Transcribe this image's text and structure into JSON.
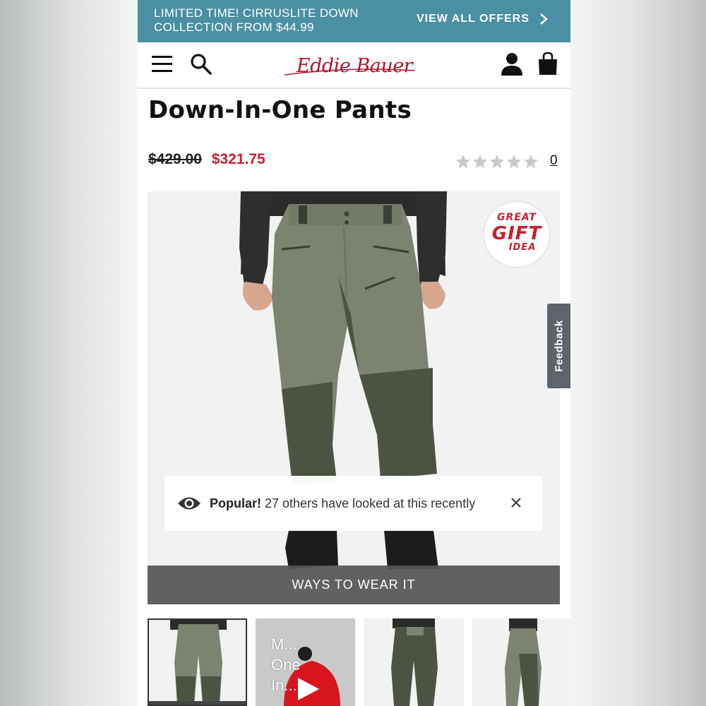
{
  "promo": {
    "text": "LIMITED TIME! CIRRUSLITE DOWN COLLECTION FROM $44.99",
    "link_label": "VIEW ALL OFFERS"
  },
  "nav": {
    "menu_icon": "hamburger-menu-icon",
    "search_icon": "search-icon",
    "logo": "Eddie Bauer",
    "account_icon": "user-account-icon",
    "cart_icon": "shopping-bag-icon"
  },
  "product": {
    "title": "Down-In-One Pants",
    "price_original": "$429.00",
    "price_sale": "$321.75",
    "rating_stars": 0,
    "rating_max": 5,
    "review_count": "0"
  },
  "badge": {
    "line1": "GREAT",
    "line2": "GIFT",
    "line3": "IDEA"
  },
  "popular_notice": {
    "strong": "Popular!",
    "text": "27 others have looked at this recently"
  },
  "ways_to_wear": "WAYS TO WEAR IT",
  "feedback_label": "Feedback",
  "thumbnails": [
    {
      "kind": "image",
      "active": true
    },
    {
      "kind": "video",
      "caption": "M... One In..."
    },
    {
      "kind": "image",
      "active": false
    },
    {
      "kind": "image",
      "active": false
    }
  ],
  "colors": {
    "promo_bg": "#4a8fa3",
    "brand_red": "#b5122b",
    "sale_red": "#c8202f",
    "pants_green": "#7a806a",
    "pants_dark": "#4a5441"
  }
}
